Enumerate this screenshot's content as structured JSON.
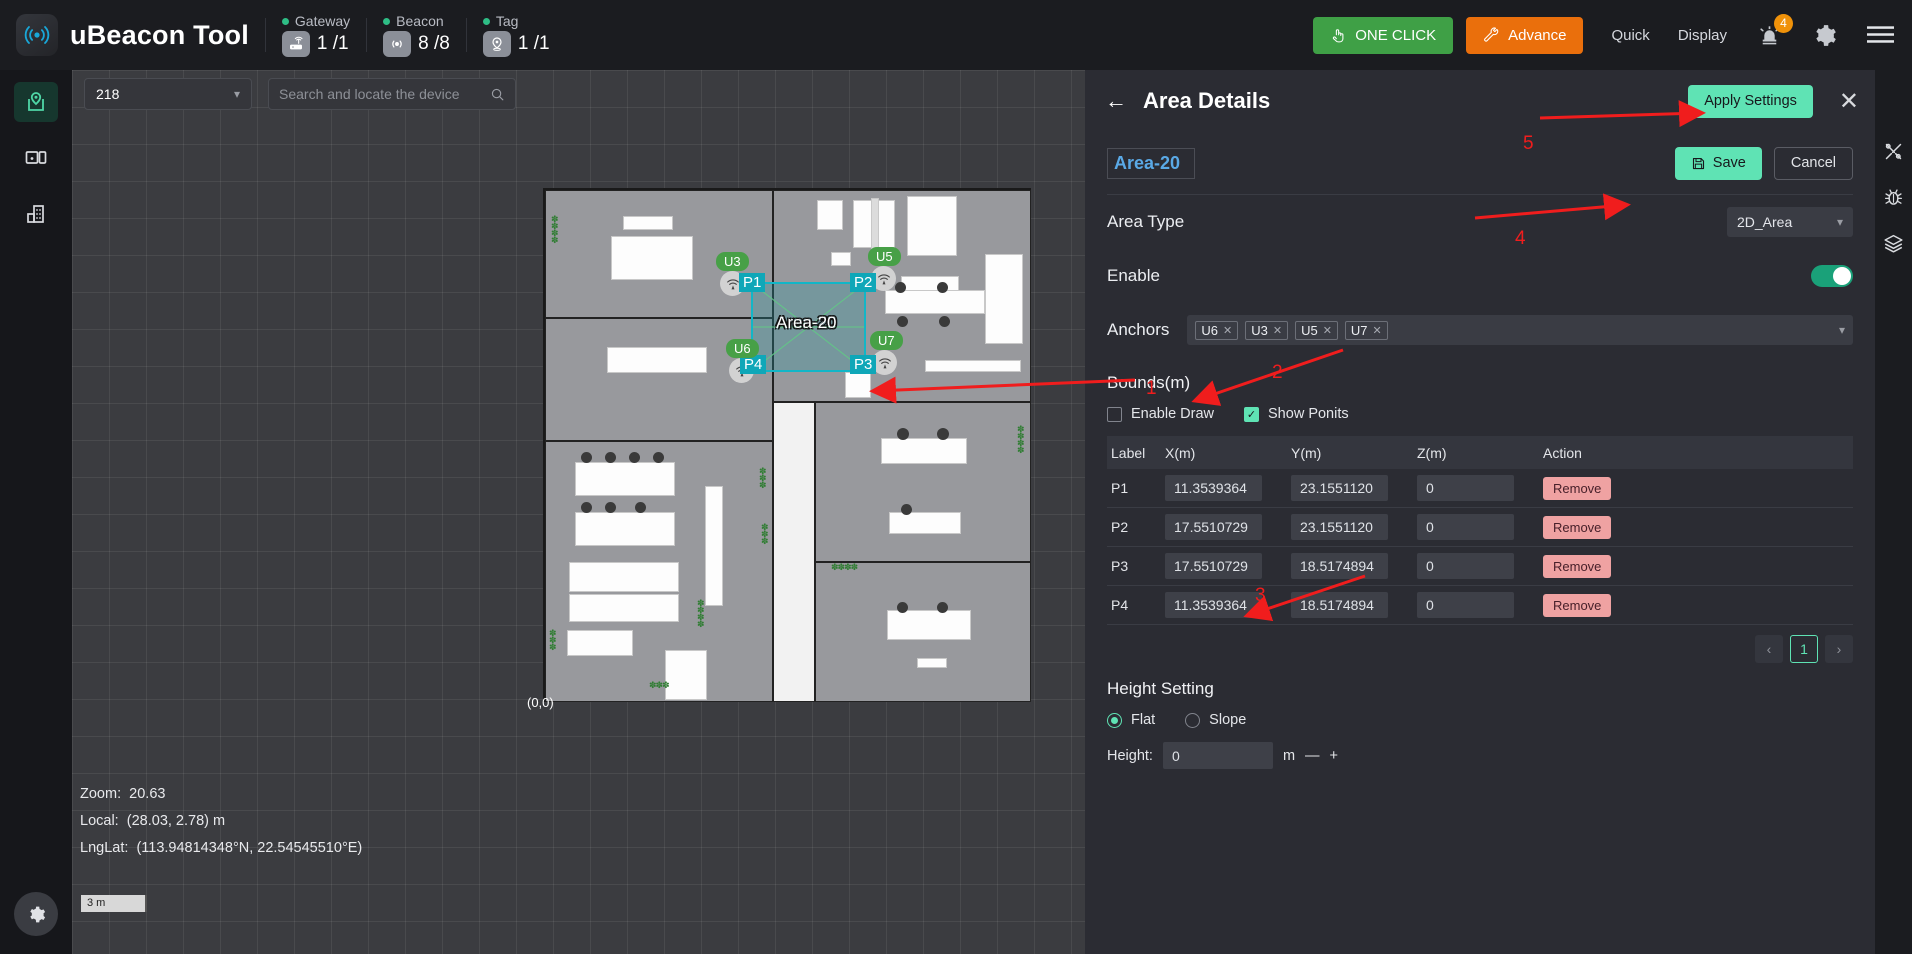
{
  "header": {
    "brand": "uBeacon Tool",
    "logo_icon": "beacon-signal-icon",
    "stats": [
      {
        "label": "Gateway",
        "value": "1 /1",
        "icon": "router-icon"
      },
      {
        "label": "Beacon",
        "value": "8 /8",
        "icon": "beacon-icon"
      },
      {
        "label": "Tag",
        "value": "1 /1",
        "icon": "tag-pin-icon"
      }
    ],
    "one_click_label": "ONE CLICK",
    "one_click_icon": "hand-click-icon",
    "one_click_color": "#3fa046",
    "advance_label": "Advance",
    "advance_icon": "wrench-icon",
    "advance_color": "#ea6f0c",
    "quick_label": "Quick",
    "display_label": "Display",
    "alarm_icon": "alarm-bell-icon",
    "alarm_badge": "4",
    "badge_color": "#f0920a",
    "settings_icon": "gear-icon",
    "menu_icon": "hamburger-menu-icon"
  },
  "left_rail": {
    "items": [
      {
        "name": "map-view",
        "icon": "location-pin-map-icon",
        "active": true
      },
      {
        "name": "device-view",
        "icon": "device-monitor-icon",
        "active": false
      },
      {
        "name": "building-view",
        "icon": "building-icon",
        "active": false
      }
    ],
    "gear_icon": "gear-icon"
  },
  "map": {
    "floor_select_value": "218",
    "floor_select_icon": "chevron-down-icon",
    "search_placeholder": "Search and locate the device",
    "search_value": "",
    "search_icon": "search-icon",
    "info": {
      "zoom_label": "Zoom:",
      "zoom_value": "20.63",
      "local_label": "Local:",
      "local_value": "(28.03,  2.78)  m",
      "lnglat_label": "LngLat:",
      "lnglat_value": "(113.94814348°N,  22.54545510°E)"
    },
    "scale_label": "3 m",
    "origin_label": "(0,0)",
    "area_label": "Area-20",
    "point_labels": [
      "P1",
      "P2",
      "P3",
      "P4"
    ],
    "anchor_labels": [
      "U3",
      "U5",
      "U6",
      "U7"
    ],
    "anchor_icon": "wifi-anchor-icon",
    "polygon_color": "#12b6c7"
  },
  "annotations": {
    "numbers": [
      "1",
      "2",
      "3",
      "4",
      "5"
    ],
    "color": "#f01d1d"
  },
  "panel": {
    "title": "Area Details",
    "back_icon": "arrow-left-icon",
    "apply_label": "Apply Settings",
    "close_icon": "close-icon",
    "accent_color": "#5fe3b4",
    "area_name": "Area-20",
    "save_label": "Save",
    "save_icon": "floppy-disk-icon",
    "cancel_label": "Cancel",
    "area_type_label": "Area Type",
    "area_type_value": "2D_Area",
    "enable_label": "Enable",
    "enable_on": true,
    "anchors_label": "Anchors",
    "anchor_chips": [
      "U6",
      "U3",
      "U5",
      "U7"
    ],
    "bounds_title": "Bounds(m)",
    "enable_draw_label": "Enable Draw",
    "enable_draw_checked": false,
    "show_points_label": "Show Ponits",
    "show_points_checked": true,
    "table": {
      "headers": [
        "Label",
        "X(m)",
        "Y(m)",
        "Z(m)",
        "Action"
      ],
      "remove_label": "Remove",
      "rows": [
        {
          "label": "P1",
          "x": "11.3539364",
          "y": "23.1551120",
          "z": "0"
        },
        {
          "label": "P2",
          "x": "17.5510729",
          "y": "23.1551120",
          "z": "0"
        },
        {
          "label": "P3",
          "x": "17.5510729",
          "y": "18.5174894",
          "z": "0"
        },
        {
          "label": "P4",
          "x": "11.3539364",
          "y": "18.5174894",
          "z": "0"
        }
      ]
    },
    "pagination": {
      "prev_icon": "chevron-left-icon",
      "current": "1",
      "next_icon": "chevron-right-icon"
    },
    "height_title": "Height Setting",
    "flat_label": "Flat",
    "slope_label": "Slope",
    "mode": "Flat",
    "height_label": "Height:",
    "height_value": "0",
    "height_unit": "m",
    "minus_label": "—",
    "plus_label": "+"
  },
  "right_rail": {
    "items": [
      {
        "name": "tools",
        "icon": "tools-cross-icon"
      },
      {
        "name": "debug",
        "icon": "bug-icon"
      },
      {
        "name": "layers",
        "icon": "layers-icon"
      }
    ]
  }
}
